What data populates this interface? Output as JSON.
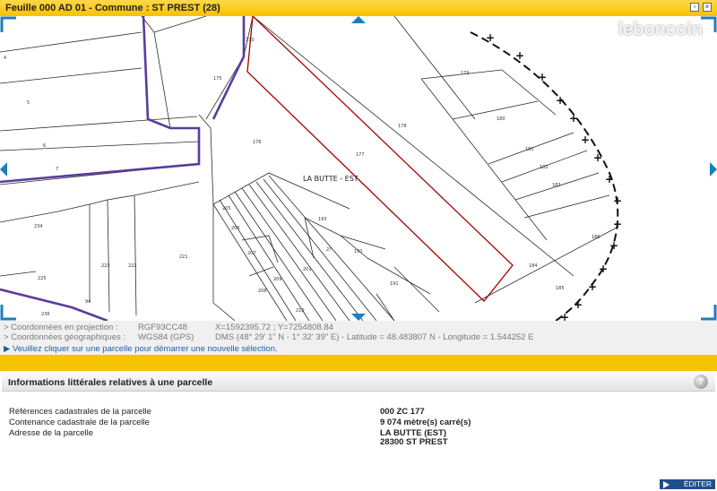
{
  "window": {
    "title": "Feuille 000 AD 01 - Commune : ST PREST (28)"
  },
  "watermark": "leboncoin",
  "map": {
    "place_label": "LA BUTTE - EST",
    "parcels": [
      {
        "num": "4"
      },
      {
        "num": "5"
      },
      {
        "num": "6"
      },
      {
        "num": "7"
      },
      {
        "num": "234"
      },
      {
        "num": "225"
      },
      {
        "num": "223"
      },
      {
        "num": "222"
      },
      {
        "num": "221"
      },
      {
        "num": "236"
      },
      {
        "num": "94"
      },
      {
        "num": "170"
      },
      {
        "num": "175"
      },
      {
        "num": "176"
      },
      {
        "num": "177"
      },
      {
        "num": "178"
      },
      {
        "num": "179"
      },
      {
        "num": "180"
      },
      {
        "num": "181"
      },
      {
        "num": "182"
      },
      {
        "num": "183"
      },
      {
        "num": "184"
      },
      {
        "num": "185"
      },
      {
        "num": "186"
      },
      {
        "num": "192"
      },
      {
        "num": "193"
      },
      {
        "num": "191"
      },
      {
        "num": "205"
      },
      {
        "num": "206"
      },
      {
        "num": "207"
      },
      {
        "num": "208"
      },
      {
        "num": "209"
      },
      {
        "num": "201"
      },
      {
        "num": "210"
      },
      {
        "num": "2?"
      }
    ],
    "colors": {
      "commune_boundary": "#5a3c9a",
      "selected_parcel": "#a80000",
      "parcel_line": "#2b2b2b"
    }
  },
  "coords": {
    "projection_label": "> Coordonnées en projection :",
    "projection_system": "RGF93CC48",
    "projection_value": "X=1592395.72 ; Y=7254808.84",
    "geo_label": "> Coordonnées géographiques :",
    "geo_system": "WGS84 (GPS)",
    "geo_value": "DMS (48° 29' 1\" N - 1° 32' 39\" E) - Latitude = 48.483807 N - Longitude = 1.544252 E",
    "message": "▶ Veuillez cliquer sur une parcelle pour démarrer une nouvelle sélection."
  },
  "panel": {
    "title": "Informations littérales relatives à une parcelle",
    "help": "?",
    "rows": [
      {
        "label": "Références cadastrales de la parcelle",
        "value": "000 ZC 177"
      },
      {
        "label": "Contenance cadastrale de la parcelle",
        "value": "9 074 mètre(s) carré(s)"
      },
      {
        "label": "Adresse de la parcelle",
        "value": "LA BUTTE (EST)",
        "value2": "28300 ST PREST"
      }
    ],
    "edit_label": "ÉDITER"
  }
}
